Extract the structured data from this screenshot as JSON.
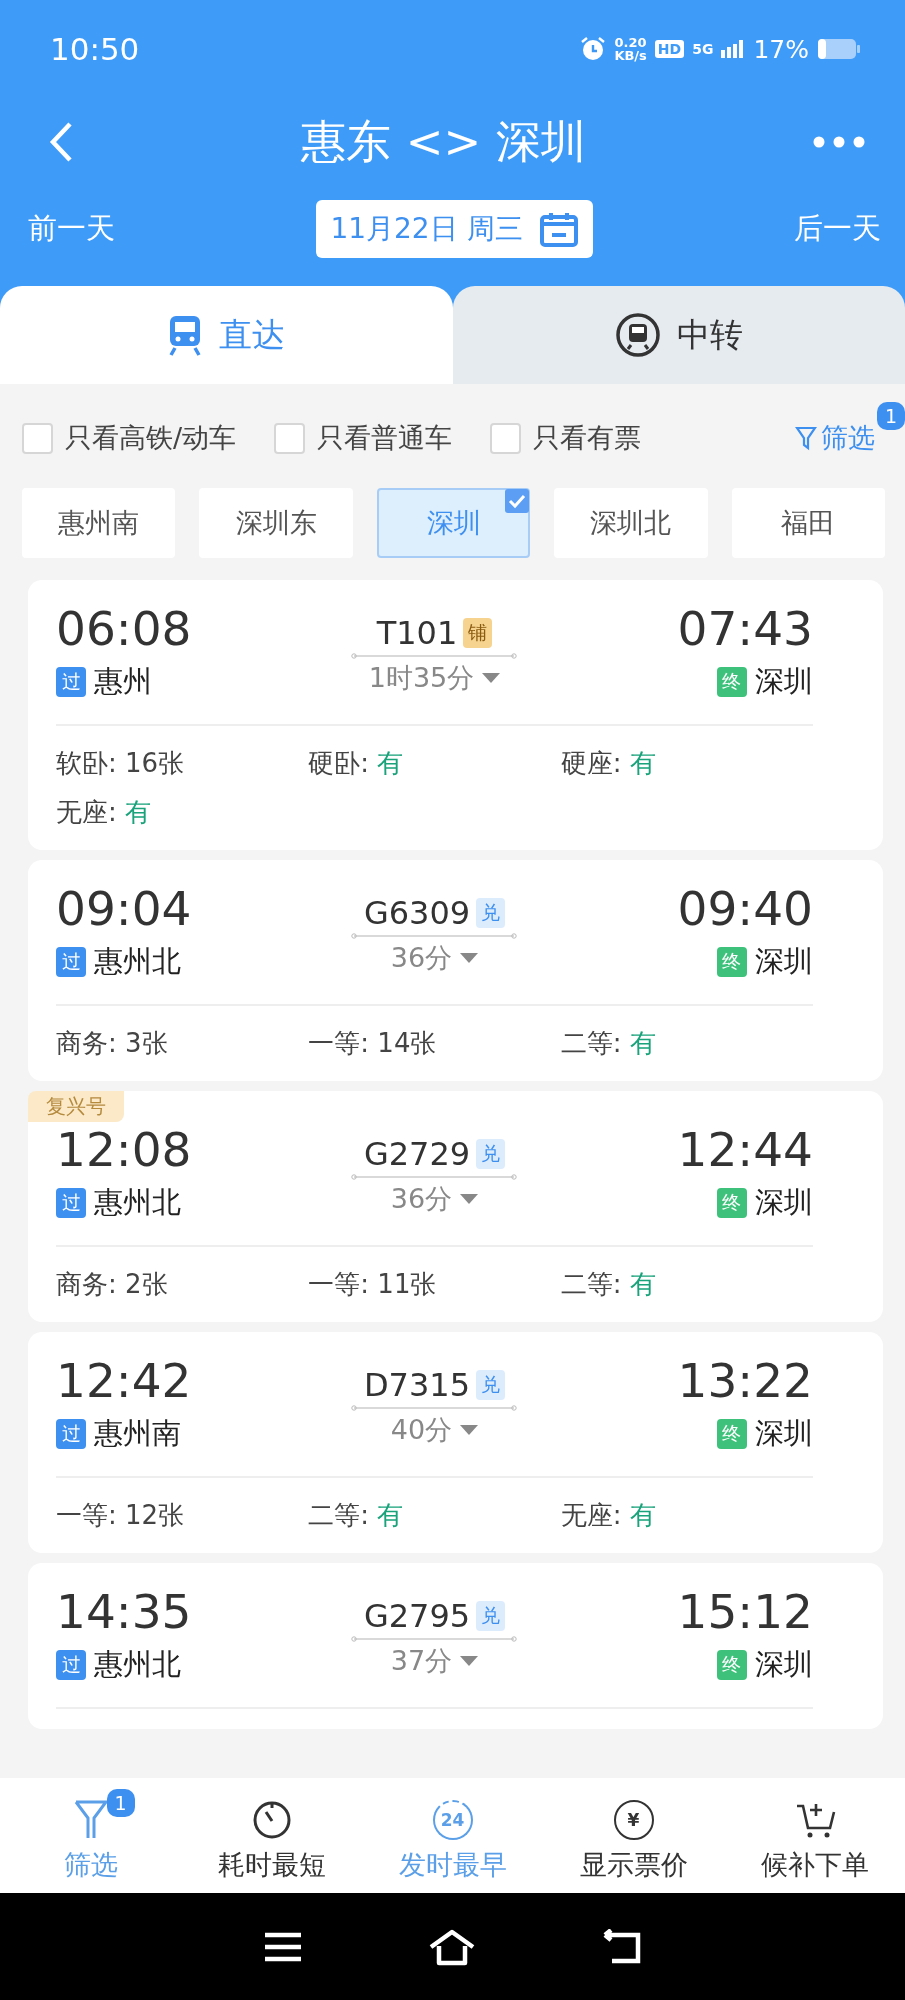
{
  "status_bar": {
    "time": "10:50",
    "speed": "0.20",
    "speed_unit": "KB/s",
    "hd": "HD",
    "network": "5G",
    "battery": "17%"
  },
  "header": {
    "title": "惠东 <> 深圳",
    "prev_day": "前一天",
    "date": "11月22日 周三",
    "next_day": "后一天"
  },
  "tabs": [
    {
      "label": "直达",
      "kind": "train",
      "selected": true
    },
    {
      "label": "中转",
      "kind": "transfer",
      "selected": false
    }
  ],
  "options": [
    {
      "label": "只看高铁/动车",
      "checked": false
    },
    {
      "label": "只看普通车",
      "checked": false
    },
    {
      "label": "只看有票",
      "checked": false
    }
  ],
  "filter": {
    "label": "筛选",
    "badge": "1"
  },
  "stations": [
    {
      "label": "惠州南",
      "selected": false
    },
    {
      "label": "深圳东",
      "selected": false
    },
    {
      "label": "深圳",
      "selected": true
    },
    {
      "label": "深圳北",
      "selected": false
    },
    {
      "label": "福田",
      "selected": false
    }
  ],
  "trains": [
    {
      "depart": "06:08",
      "from_tag": "过",
      "from": "惠州",
      "number": "T101",
      "tag": "铺",
      "kind": "berth",
      "duration": "1时35分",
      "arrive": "07:43",
      "to_tag": "终",
      "to": "深圳",
      "seats": [
        {
          "label": "软卧:",
          "value": "16张",
          "plenty": false
        },
        {
          "label": "硬卧:",
          "value": "有",
          "plenty": true
        },
        {
          "label": "硬座:",
          "value": "有",
          "plenty": true
        },
        {
          "label": "无座:",
          "value": "有",
          "plenty": true
        }
      ]
    },
    {
      "depart": "09:04",
      "from_tag": "过",
      "from": "惠州北",
      "number": "G6309",
      "tag": "兑",
      "kind": "redeem",
      "duration": "36分",
      "arrive": "09:40",
      "to_tag": "终",
      "to": "深圳",
      "seats": [
        {
          "label": "商务:",
          "value": "3张",
          "plenty": false
        },
        {
          "label": "一等:",
          "value": "14张",
          "plenty": false
        },
        {
          "label": "二等:",
          "value": "有",
          "plenty": true
        }
      ]
    },
    {
      "ribbon": "复兴号",
      "depart": "12:08",
      "from_tag": "过",
      "from": "惠州北",
      "number": "G2729",
      "tag": "兑",
      "kind": "redeem",
      "duration": "36分",
      "arrive": "12:44",
      "to_tag": "终",
      "to": "深圳",
      "seats": [
        {
          "label": "商务:",
          "value": "2张",
          "plenty": false
        },
        {
          "label": "一等:",
          "value": "11张",
          "plenty": false
        },
        {
          "label": "二等:",
          "value": "有",
          "plenty": true
        }
      ]
    },
    {
      "depart": "12:42",
      "from_tag": "过",
      "from": "惠州南",
      "number": "D7315",
      "tag": "兑",
      "kind": "redeem",
      "duration": "40分",
      "arrive": "13:22",
      "to_tag": "终",
      "to": "深圳",
      "seats": [
        {
          "label": "一等:",
          "value": "12张",
          "plenty": false
        },
        {
          "label": "二等:",
          "value": "有",
          "plenty": true
        },
        {
          "label": "无座:",
          "value": "有",
          "plenty": true
        }
      ]
    },
    {
      "depart": "14:35",
      "from_tag": "过",
      "from": "惠州北",
      "number": "G2795",
      "tag": "兑",
      "kind": "redeem",
      "duration": "37分",
      "arrive": "15:12",
      "to_tag": "终",
      "to": "深圳"
    }
  ],
  "bottom_bar": [
    {
      "label": "筛选",
      "kind": "filter",
      "badge": "1",
      "selected": true
    },
    {
      "label": "耗时最短",
      "kind": "timer",
      "selected": false
    },
    {
      "label": "发时最早",
      "kind": "clock24",
      "icon_text": "24",
      "selected": true
    },
    {
      "label": "显示票价",
      "kind": "yen",
      "icon_text": "¥",
      "selected": false
    },
    {
      "label": "候补下单",
      "kind": "cart",
      "selected": false
    }
  ]
}
